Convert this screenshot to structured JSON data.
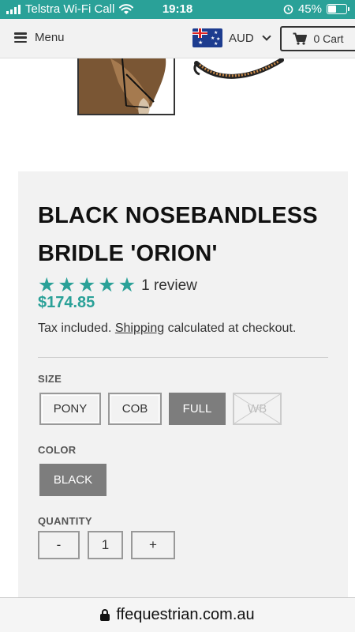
{
  "status_bar": {
    "carrier": "Telstra Wi-Fi Call",
    "time": "19:18",
    "battery": "45%",
    "battery_level": 0.45
  },
  "header": {
    "menu_label": "Menu",
    "currency": "AUD",
    "cart_label": "0 Cart"
  },
  "product": {
    "title": "BLACK NOSEBANDLESS BRIDLE 'ORION'",
    "rating_stars": 5,
    "review_count": "1 review",
    "price": "$174.85",
    "tax_prefix": "Tax included.",
    "shipping_link": "Shipping",
    "tax_suffix": "calculated at checkout.",
    "size": {
      "label": "SIZE",
      "options": [
        "PONY",
        "COB",
        "FULL",
        "WB"
      ],
      "selected": "FULL",
      "unavailable": [
        "WB"
      ]
    },
    "color": {
      "label": "COLOR",
      "options": [
        "BLACK"
      ],
      "selected": "BLACK"
    },
    "quantity": {
      "label": "QUANTITY",
      "decrement": "-",
      "value": "1",
      "increment": "+"
    }
  },
  "browser": {
    "url": "ffequestrian.com.au"
  }
}
